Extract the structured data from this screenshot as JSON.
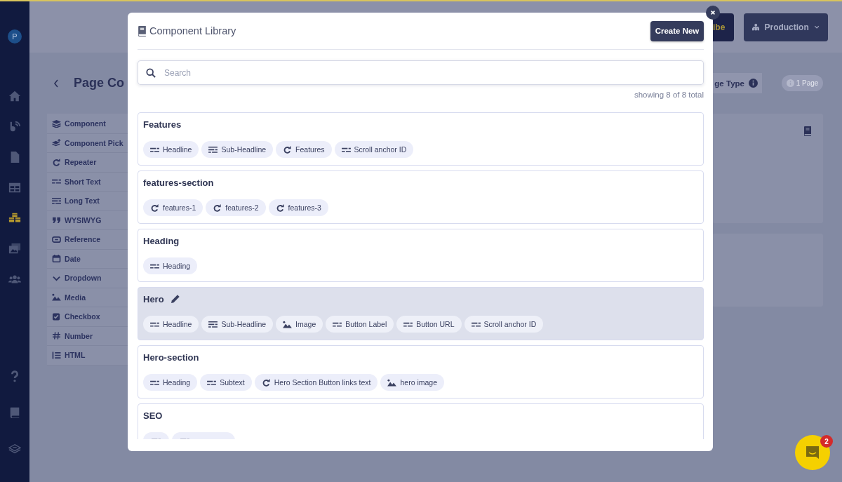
{
  "top_bar": {
    "buttons": [
      {
        "kind": "subscribe",
        "label": "ibe"
      },
      {
        "kind": "environment",
        "label": "Production"
      }
    ]
  },
  "nav": {
    "avatar": "P",
    "items": [
      {
        "kind": "home",
        "selected": false
      },
      {
        "kind": "broadcast",
        "selected": false
      },
      {
        "kind": "document",
        "selected": false
      },
      {
        "kind": "table",
        "selected": false
      },
      {
        "kind": "cubes",
        "selected": true
      },
      {
        "kind": "images",
        "selected": false
      },
      {
        "kind": "users",
        "selected": false
      }
    ],
    "bottom_items": [
      {
        "kind": "help",
        "selected": false
      },
      {
        "kind": "book",
        "selected": false
      },
      {
        "kind": "stack",
        "selected": false
      }
    ]
  },
  "page": {
    "title": "Page Co",
    "page_type": "ge Type",
    "pages_badge": "1 Page",
    "field_types": [
      {
        "kind": "component",
        "label": "Component"
      },
      {
        "kind": "picker",
        "label": "Component Pick"
      },
      {
        "kind": "repeater",
        "label": "Repeater"
      },
      {
        "kind": "short",
        "label": "Short Text"
      },
      {
        "kind": "long",
        "label": "Long Text"
      },
      {
        "kind": "wysiwyg",
        "label": "WYSIWYG"
      },
      {
        "kind": "reference",
        "label": "Reference"
      },
      {
        "kind": "date",
        "label": "Date"
      },
      {
        "kind": "dropdown",
        "label": "Dropdown"
      },
      {
        "kind": "image",
        "label": "Media"
      },
      {
        "kind": "checkbox",
        "label": "Checkbox"
      },
      {
        "kind": "number",
        "label": "Number"
      },
      {
        "kind": "html",
        "label": "HTML"
      }
    ]
  },
  "modal": {
    "title": "Component Library",
    "create_button": "Create New",
    "search": {
      "placeholder": "Search"
    },
    "count": "showing 8 of 8 total",
    "components": [
      {
        "name": "Features",
        "selected": false,
        "fields": [
          {
            "kind": "short",
            "label": "Headline"
          },
          {
            "kind": "long",
            "label": "Sub-Headline"
          },
          {
            "kind": "repeater",
            "label": "Features"
          },
          {
            "kind": "short",
            "label": "Scroll anchor ID"
          }
        ]
      },
      {
        "name": "features-section",
        "selected": false,
        "fields": [
          {
            "kind": "repeater",
            "label": "features-1"
          },
          {
            "kind": "repeater",
            "label": "features-2"
          },
          {
            "kind": "repeater",
            "label": "features-3"
          }
        ]
      },
      {
        "name": "Heading",
        "selected": false,
        "fields": [
          {
            "kind": "short",
            "label": "Heading"
          }
        ]
      },
      {
        "name": "Hero",
        "selected": true,
        "fields": [
          {
            "kind": "short",
            "label": "Headline"
          },
          {
            "kind": "long",
            "label": "Sub-Headline"
          },
          {
            "kind": "image",
            "label": "Image"
          },
          {
            "kind": "short",
            "label": "Button Label"
          },
          {
            "kind": "short",
            "label": "Button URL"
          },
          {
            "kind": "short",
            "label": "Scroll anchor ID"
          }
        ]
      },
      {
        "name": "Hero-section",
        "selected": false,
        "fields": [
          {
            "kind": "short",
            "label": "Heading"
          },
          {
            "kind": "short",
            "label": "Subtext"
          },
          {
            "kind": "repeater",
            "label": "Hero Section Button links text"
          },
          {
            "kind": "image",
            "label": "hero image"
          }
        ]
      },
      {
        "name": "SEO",
        "selected": false,
        "fields": [
          {
            "kind": "short"
          },
          {
            "kind": "short"
          }
        ]
      }
    ]
  },
  "chat": {
    "badge": "2"
  }
}
